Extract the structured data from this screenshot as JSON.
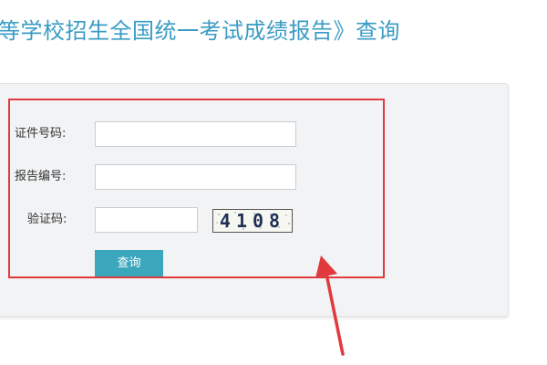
{
  "header": {
    "title": "等学校招生全国统一考试成绩报告》查询"
  },
  "form": {
    "id_label": "证件号码:",
    "id_value": "",
    "report_label": "报告编号:",
    "report_value": "",
    "captcha_label": "验证码:",
    "captcha_value": "",
    "captcha_code": "4108",
    "submit_label": "查询"
  },
  "annotation": {
    "box_color": "#e03a3e",
    "arrow_color": "#e03a3e"
  },
  "colors": {
    "title": "#3a9cc4",
    "button": "#3ba7bd",
    "panel": "#f2f3f4"
  }
}
